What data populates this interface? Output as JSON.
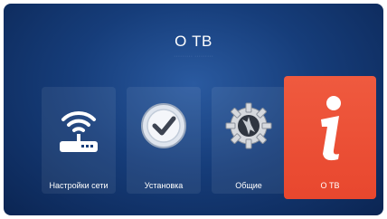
{
  "screen": {
    "title": "О ТВ",
    "subtitle": "·········  ·········",
    "accent_color": "#e8472e",
    "background_color": "#163d7a"
  },
  "menu": {
    "items": [
      {
        "label": "Настройки сети",
        "icon": "router-wifi-icon",
        "selected": false
      },
      {
        "label": "Установка",
        "icon": "clock-check-icon",
        "selected": false
      },
      {
        "label": "Общие",
        "icon": "gear-icon",
        "selected": false
      },
      {
        "label": "О ТВ",
        "icon": "info-icon",
        "selected": true
      }
    ]
  }
}
